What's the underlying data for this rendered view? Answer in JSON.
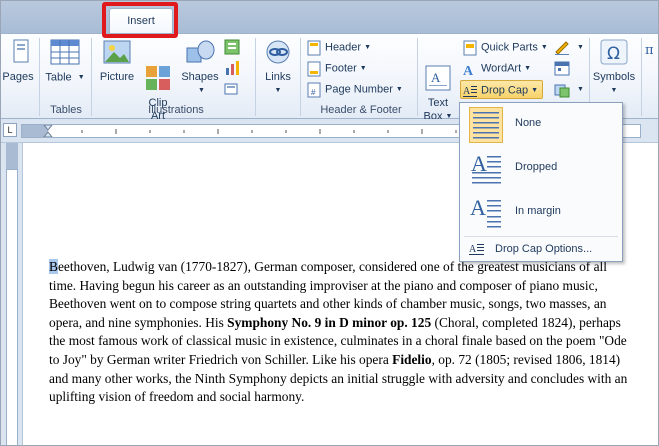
{
  "tabs": {
    "active": "Insert"
  },
  "ribbon": {
    "pages_label": "Pages",
    "tables": {
      "table_label": "Table",
      "group": "Tables"
    },
    "illustrations": {
      "picture": "Picture",
      "clipart": "Clip\nArt",
      "shapes": "Shapes",
      "group": "Illustrations"
    },
    "links": {
      "label": "Links"
    },
    "header_footer": {
      "header": "Header",
      "footer": "Footer",
      "page_number": "Page Number",
      "group": "Header & Footer"
    },
    "text": {
      "textbox": "Text\nBox",
      "quick_parts": "Quick Parts",
      "wordart": "WordArt",
      "drop_cap": "Drop Cap"
    },
    "symbols": {
      "label": "Symbols"
    }
  },
  "dropdown": {
    "items": [
      {
        "label": "None",
        "icon": "dropcap-none-icon"
      },
      {
        "label": "Dropped",
        "icon": "dropcap-dropped-icon"
      },
      {
        "label": "In margin",
        "icon": "dropcap-in-margin-icon"
      }
    ],
    "options": "Drop Cap Options..."
  },
  "document": {
    "cap_letter": "B",
    "part1": "eethoven, Ludwig van (1770-1827), German composer, considered one of the greatest musicians of all time. Having begun his career as an outstanding improviser at the piano and composer of piano music, Beethoven went on to compose string quartets and other kinds of chamber music, songs, two masses, an opera, and nine symphonies. His ",
    "bold1": "Symphony No. 9 in D minor op. 125",
    "part2": " (Choral, completed 1824), perhaps the most famous work of classical music in existence, culminates in a choral finale based on the poem \"Ode to Joy\" by German writer Friedrich von Schiller. Like his opera ",
    "bold2": "Fidelio",
    "part3": ", op. 72 (1805; revised 1806, 1814) and many other works, the Ninth Symphony depicts an initial struggle with adversity and concludes with an uplifting vision of freedom and social harmony."
  },
  "colors": {
    "highlight": "#e0191c",
    "dropcap_button": "#f8d36b",
    "selection": "#a8c8ee"
  }
}
